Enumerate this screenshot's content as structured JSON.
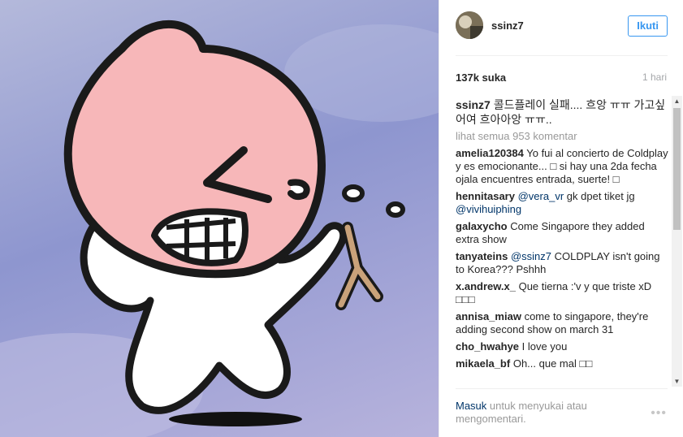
{
  "post": {
    "username": "ssinz7",
    "follow_label": "Ikuti",
    "likes": "137k suka",
    "time": "1 hari",
    "caption": "콜드플레이 실패.... 흐앙 ㅠㅠ 가고싶어여 흐아아앙 ㅠㅠ..",
    "view_all": "lihat semua 953 komentar",
    "comments": [
      {
        "user": "amelia120384",
        "text": "Yo fui al concierto de Coldplay y es emocionante... □ si hay una 2da fecha ojala encuentres entrada, suerte! □"
      },
      {
        "user": "hennitasary",
        "mention1": "@vera_vr",
        "text": "gk dpet tiket jg",
        "mention2": "@vivihuiphing"
      },
      {
        "user": "galaxycho",
        "text": "Come Singapore they added extra show"
      },
      {
        "user": "tanyateins",
        "mention1": "@ssinz7",
        "text": "COLDPLAY isn't going to Korea??? Pshhh"
      },
      {
        "user": "x.andrew.x_",
        "text": "Que tierna :'v y que triste xD □□□"
      },
      {
        "user": "annisa_miaw",
        "text": "come to singapore, they're adding second show on march 31"
      },
      {
        "user": "cho_hwahye",
        "text": "I love you"
      },
      {
        "user": "mikaela_bf",
        "text": "Oh... que mal □□"
      }
    ],
    "login_link": "Masuk",
    "login_text": "untuk menyukai atau mengomentari.",
    "more_label": "•••"
  },
  "colors": {
    "accent": "#3897f0",
    "link": "#003569",
    "muted": "#999999",
    "peach": "#f7b7b9",
    "sky": "#9aa0d6"
  },
  "icons": {
    "scroll_up": "scroll-up-icon",
    "scroll_down": "scroll-down-icon",
    "more": "more-options-icon"
  }
}
